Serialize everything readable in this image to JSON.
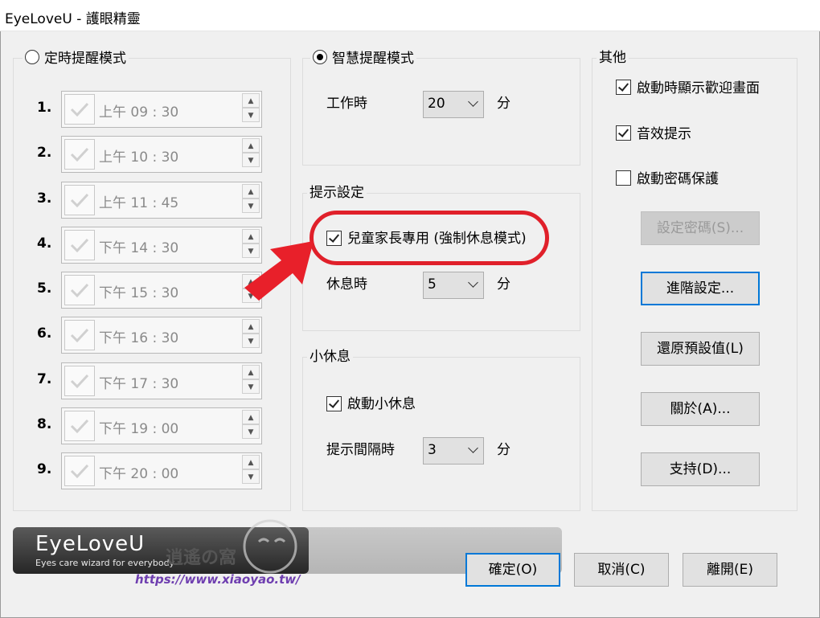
{
  "window": {
    "title": "EyeLoveU - 護眼精靈"
  },
  "timer_mode": {
    "label": "定時提醒模式",
    "items": [
      {
        "num": "1.",
        "time": "上午 09 : 30"
      },
      {
        "num": "2.",
        "time": "上午 10 : 30"
      },
      {
        "num": "3.",
        "time": "上午 11 : 45"
      },
      {
        "num": "4.",
        "time": "下午 14 : 30"
      },
      {
        "num": "5.",
        "time": "下午 15 : 30"
      },
      {
        "num": "6.",
        "time": "下午 16 : 30"
      },
      {
        "num": "7.",
        "time": "下午 17 : 30"
      },
      {
        "num": "8.",
        "time": "下午 19 : 00"
      },
      {
        "num": "9.",
        "time": "下午 20 : 00"
      }
    ]
  },
  "smart_mode": {
    "label": "智慧提醒模式",
    "work_label": "工作時",
    "work_value": "20",
    "work_unit": "分"
  },
  "prompt_settings": {
    "legend": "提示設定",
    "kids_label": "兒童家長專用 (強制休息模式)",
    "rest_label": "休息時",
    "rest_value": "5",
    "rest_unit": "分"
  },
  "short_break": {
    "legend": "小休息",
    "enable_label": "啟動小休息",
    "interval_label": "提示間隔時",
    "interval_value": "3",
    "interval_unit": "分"
  },
  "other": {
    "legend": "其他",
    "welcome_label": "啟動時顯示歡迎畫面",
    "sound_label": "音效提示",
    "password_label": "啟動密碼保護",
    "set_password_btn": "設定密碼(S)...",
    "advanced_btn": "進階設定...",
    "restore_btn": "還原預設值(L)",
    "about_btn": "關於(A)...",
    "support_btn": "支持(D)..."
  },
  "footer": {
    "logo_title": "EyeLoveU",
    "logo_subtitle": "Eyes care wizard for everybody",
    "ok_btn": "確定(O)",
    "cancel_btn": "取消(C)",
    "exit_btn": "離開(E)"
  },
  "watermark": {
    "url": "https://www.xiaoyao.tw/",
    "brand": "逍遙の窩"
  },
  "colors": {
    "highlight": "#e0202a",
    "focus": "#0078d7"
  }
}
